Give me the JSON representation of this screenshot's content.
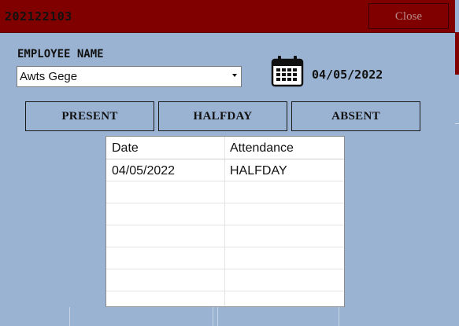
{
  "window": {
    "title": "202122103",
    "close_label": "Close",
    "accent_color": "#800000",
    "background_color": "#9ab3d3"
  },
  "employee": {
    "label": "EMPLOYEE NAME",
    "selected": "Awts Gege"
  },
  "calendar": {
    "icon": "calendar-icon",
    "date": "04/05/2022"
  },
  "actions": {
    "present_label": "PRESENT",
    "halfday_label": "HALFDAY",
    "absent_label": "ABSENT"
  },
  "table": {
    "columns": [
      "Date",
      "Attendance"
    ],
    "rows": [
      [
        "04/05/2022",
        "HALFDAY"
      ],
      [
        "",
        ""
      ],
      [
        "",
        ""
      ],
      [
        "",
        ""
      ],
      [
        "",
        ""
      ],
      [
        "",
        ""
      ],
      [
        "",
        ""
      ]
    ]
  }
}
